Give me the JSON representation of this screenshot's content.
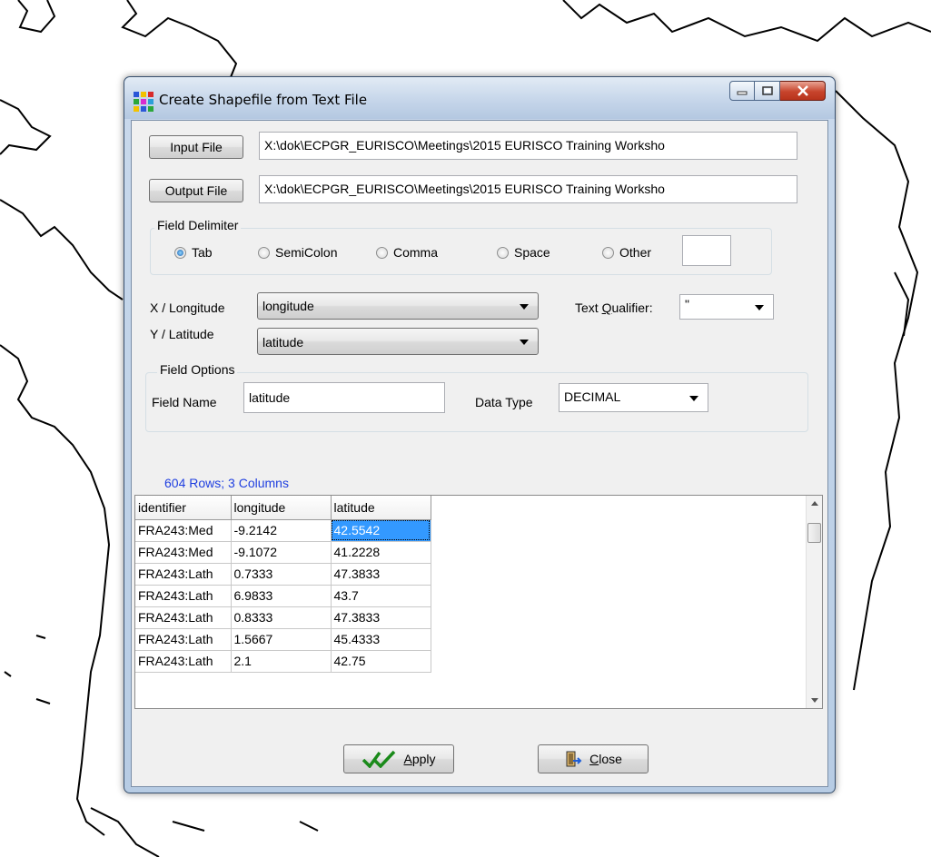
{
  "window": {
    "title": "Create Shapefile from Text File"
  },
  "files": {
    "input_button": "Input File",
    "input_path": "X:\\dok\\ECPGR_EURISCO\\Meetings\\2015 EURISCO Training Worksho",
    "output_button": "Output File",
    "output_path": "X:\\dok\\ECPGR_EURISCO\\Meetings\\2015 EURISCO Training Worksho"
  },
  "delimiter": {
    "group_label": "Field Delimiter",
    "options": [
      {
        "label": "Tab",
        "checked": true
      },
      {
        "label": "SemiColon",
        "checked": false
      },
      {
        "label": "Comma",
        "checked": false
      },
      {
        "label": "Space",
        "checked": false
      },
      {
        "label": "Other",
        "checked": false
      }
    ],
    "other_value": ""
  },
  "coords": {
    "x_label": "X / Longitude",
    "x_value": "longitude",
    "y_label": "Y / Latitude",
    "y_value": "latitude",
    "qualifier_label_pre": "Text ",
    "qualifier_label_u": "Q",
    "qualifier_label_post": "ualifier:",
    "qualifier_value": "\""
  },
  "field_options": {
    "group_label": "Field Options",
    "name_label": "Field Name",
    "name_value": "latitude",
    "type_label": "Data Type",
    "type_value": "DECIMAL"
  },
  "grid": {
    "summary": "604 Rows; 3 Columns",
    "columns": [
      "identifier",
      "longitude",
      "latitude"
    ],
    "rows": [
      [
        "FRA243:Med",
        "-9.2142",
        "42.5542"
      ],
      [
        "FRA243:Med",
        "-9.1072",
        "41.2228"
      ],
      [
        "FRA243:Lath",
        "0.7333",
        "47.3833"
      ],
      [
        "FRA243:Lath",
        "6.9833",
        "43.7"
      ],
      [
        "FRA243:Lath",
        "0.8333",
        "47.3833"
      ],
      [
        "FRA243:Lath",
        "1.5667",
        "45.4333"
      ],
      [
        "FRA243:Lath",
        "2.1",
        "42.75"
      ]
    ]
  },
  "buttons": {
    "apply_u": "A",
    "apply_rest": "pply",
    "close_u": "C",
    "close_rest": "lose"
  },
  "colors": {
    "row_count_text": "#1f3fe0",
    "selection": "#3399ff",
    "close_button": "#c7442c"
  }
}
